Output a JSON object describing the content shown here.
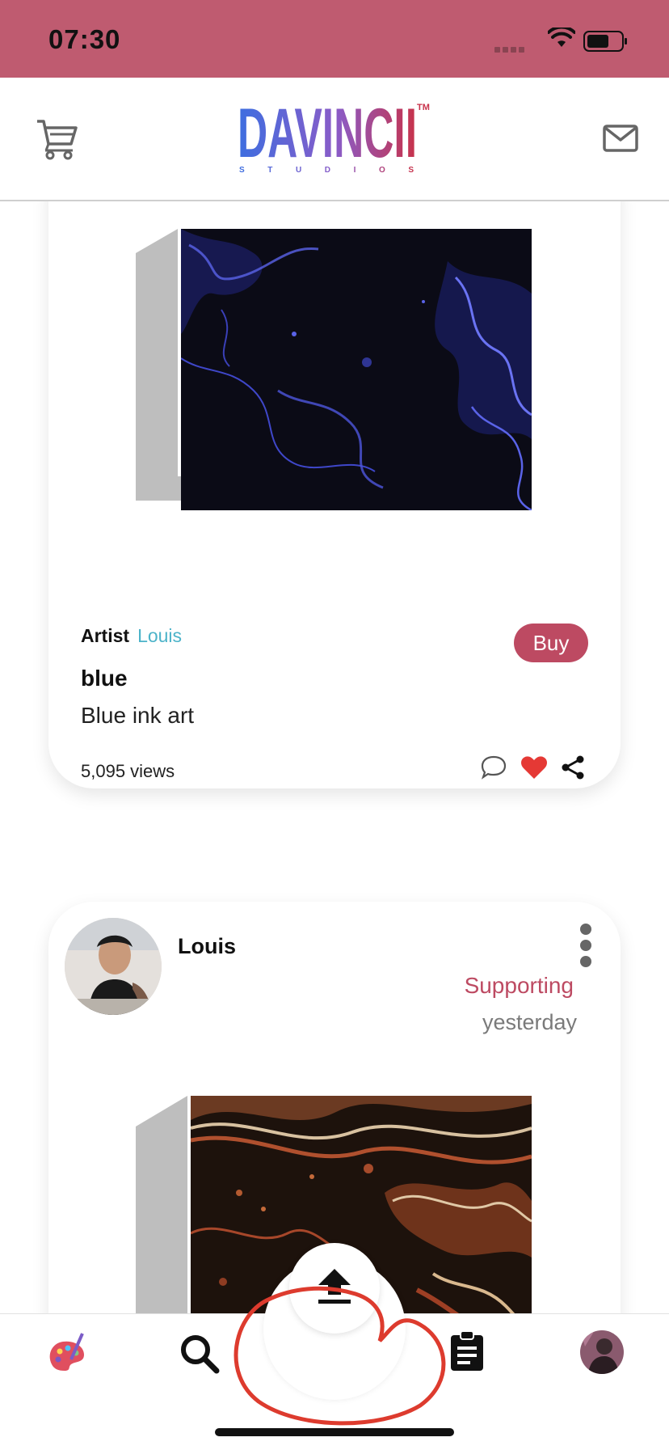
{
  "status_bar": {
    "time": "07:30"
  },
  "header": {
    "logo_text": "DAVINCII",
    "logo_sub": "S T U D I O S",
    "logo_tm": "TM"
  },
  "posts": [
    {
      "artist_label": "Artist",
      "artist_name": "Louis",
      "buy_label": "Buy",
      "title": "blue",
      "description": "Blue ink art",
      "views": "5,095 views"
    },
    {
      "user_name": "Louis",
      "relation": "Supporting",
      "time": "yesterday"
    }
  ],
  "tab_bar": {
    "items": [
      "palette-icon",
      "search-icon",
      "upload-icon",
      "clipboard-icon",
      "profile-avatar"
    ]
  },
  "colors": {
    "status_bar": "#bf5b70",
    "accent": "#bd4a62",
    "artist_link": "#4cb3c9",
    "like": "#e53935"
  }
}
